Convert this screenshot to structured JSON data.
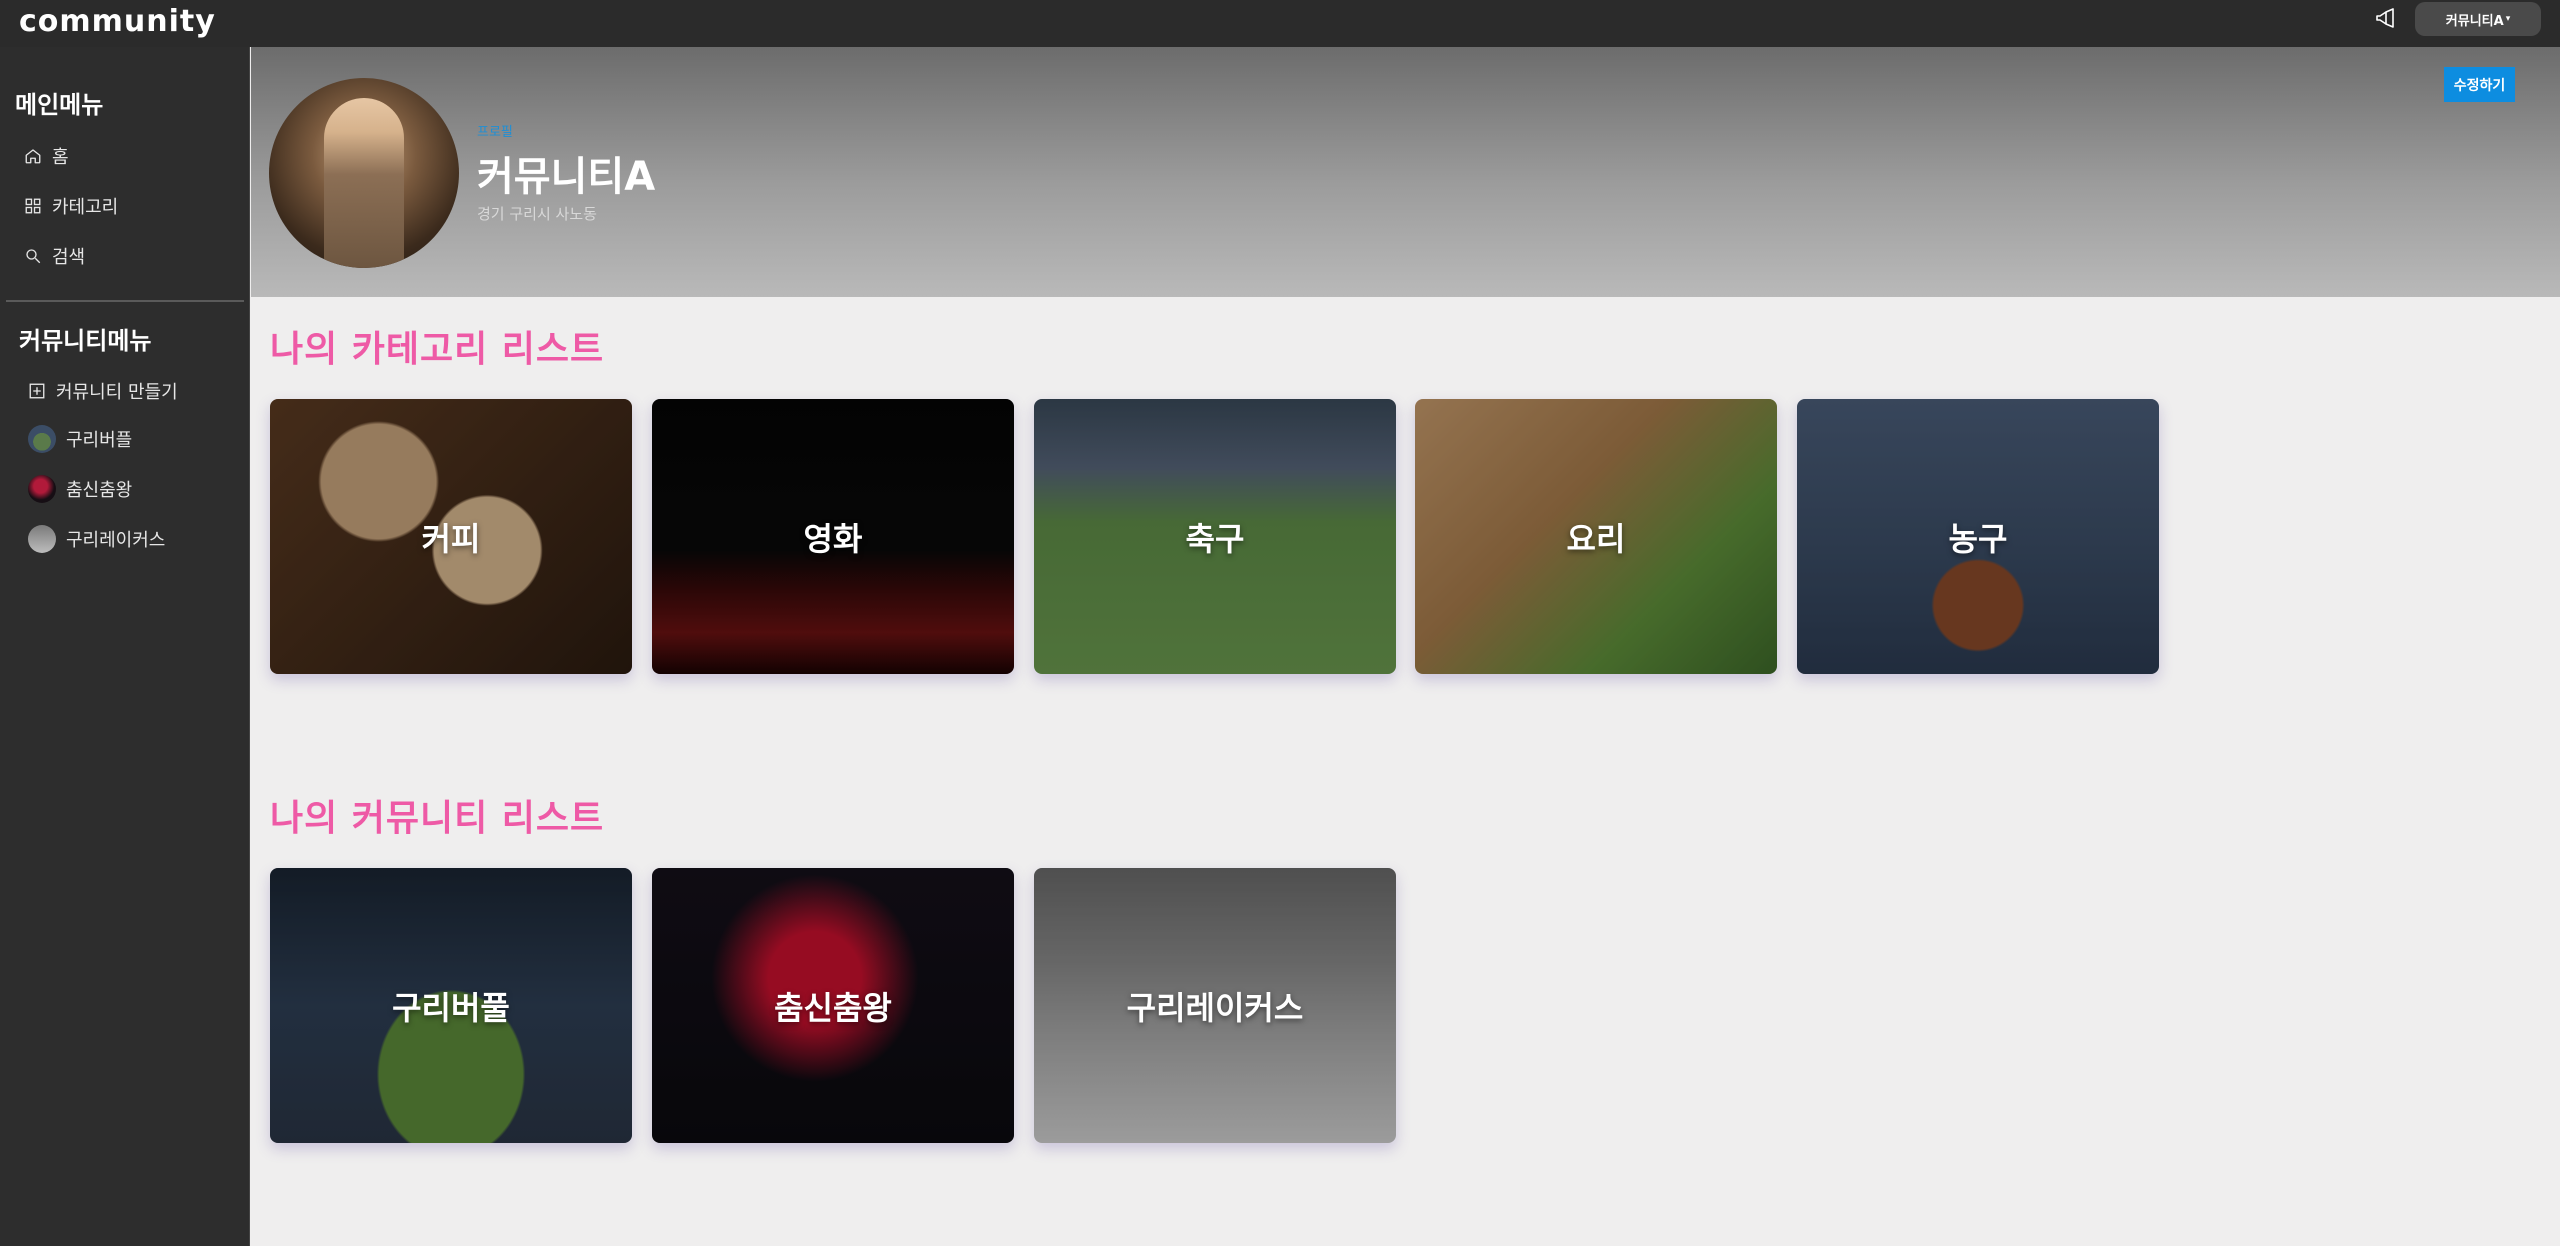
{
  "topbar": {
    "logo": "community",
    "user_menu_label": "커뮤니티A"
  },
  "sidebar": {
    "main_heading": "메인메뉴",
    "main_items": [
      {
        "label": "홈",
        "icon": "home-icon"
      },
      {
        "label": "카테고리",
        "icon": "grid-icon"
      },
      {
        "label": "검색",
        "icon": "search-icon"
      }
    ],
    "community_heading": "커뮤니티메뉴",
    "create_label": "커뮤니티 만들기",
    "communities": [
      {
        "label": "구리버플",
        "color": "#6b8aa8"
      },
      {
        "label": "춤신춤왕",
        "color": "#b11a3a"
      },
      {
        "label": "구리레이커스",
        "color": "#9a9a9a"
      }
    ]
  },
  "banner": {
    "profile_label": "프로필",
    "profile_name": "커뮤니티A",
    "location": "경기 구리시 사노동",
    "edit_label": "수정하기"
  },
  "sections": {
    "categories_title": "나의 카테고리 리스트",
    "categories": [
      {
        "label": "커피",
        "theme": "coffee"
      },
      {
        "label": "영화",
        "theme": "movie"
      },
      {
        "label": "축구",
        "theme": "soccer"
      },
      {
        "label": "요리",
        "theme": "cooking"
      },
      {
        "label": "농구",
        "theme": "basketball"
      }
    ],
    "communities_title": "나의 커뮤니티 리스트",
    "communities": [
      {
        "label": "구리버풀",
        "theme": "stadium"
      },
      {
        "label": "춤신춤왕",
        "theme": "dance"
      },
      {
        "label": "구리레이커스",
        "theme": "court"
      }
    ]
  },
  "colors": {
    "accent_pink": "#ee5aa6",
    "accent_blue": "#0d8de0",
    "topbar_bg": "#2b2b2b",
    "sidebar_bg": "#2d2d2d"
  }
}
